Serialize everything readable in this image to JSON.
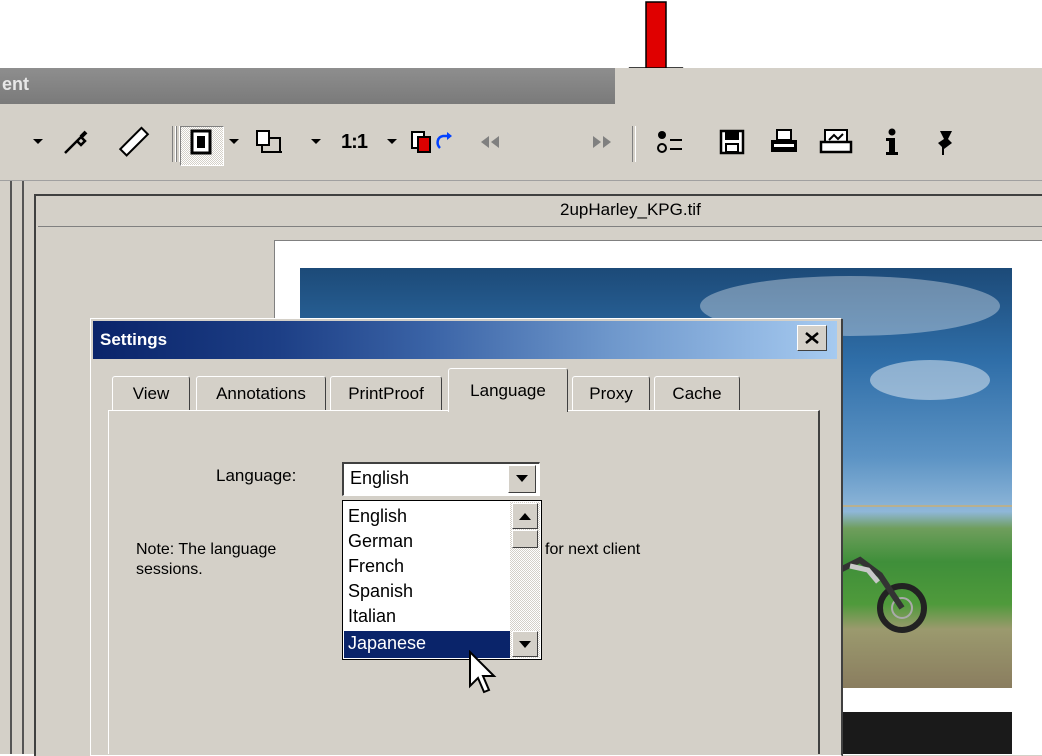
{
  "app": {
    "title_fragment": "ent",
    "document_title": "2upHarley_KPG.tif"
  },
  "toolbar": {
    "icons": [
      "dropdown-arrow",
      "eyedropper",
      "ruler",
      "single-page",
      "dropdown-arrow",
      "page-layout",
      "dropdown-arrow",
      "zoom-ratio",
      "dropdown-arrow",
      "page-rotate",
      "previous-page",
      "next-page",
      "settings",
      "save",
      "print",
      "scan",
      "info",
      "pin"
    ],
    "zoom_ratio_label": "1:1"
  },
  "dialog": {
    "title": "Settings",
    "close_label": "×",
    "tabs": [
      "View",
      "Annotations",
      "PrintProof",
      "Language",
      "Proxy",
      "Cache"
    ],
    "active_tab": "Language",
    "language_label": "Language:",
    "language_value": "English",
    "note_part1": "Note: The language",
    "note_part2": "for next client",
    "note_part3": "sessions.",
    "language_options": [
      "English",
      "German",
      "French",
      "Spanish",
      "Italian",
      "Japanese"
    ],
    "highlighted_option": "Japanese"
  },
  "colors": {
    "accent_arrow": "#e00000",
    "dialog_title_start": "#0a246a",
    "selection": "#0a246a",
    "chrome": "#d4d0c8"
  }
}
